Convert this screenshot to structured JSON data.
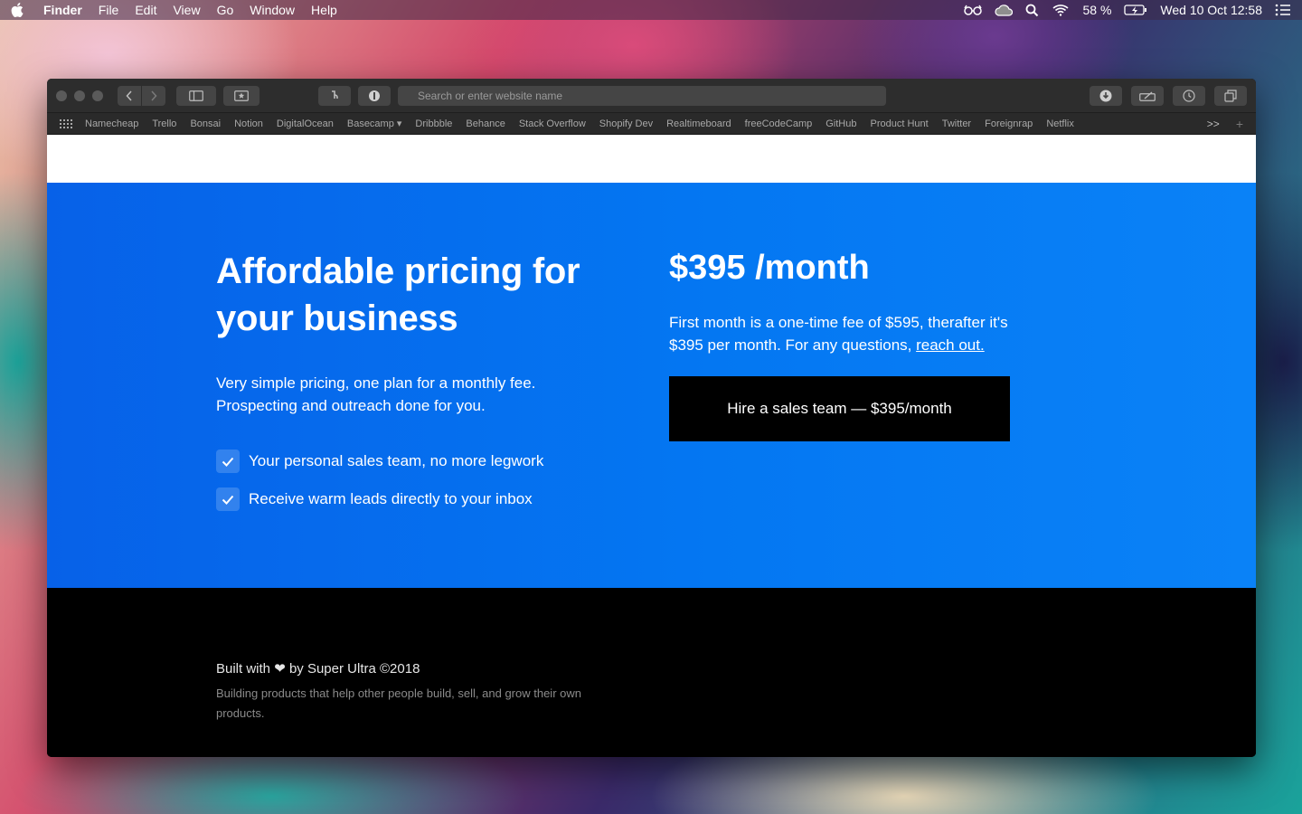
{
  "menubar": {
    "app_name": "Finder",
    "items": [
      "File",
      "Edit",
      "View",
      "Go",
      "Window",
      "Help"
    ],
    "battery": "58 %",
    "clock": "Wed 10 Oct  12:58"
  },
  "browser": {
    "address_placeholder": "Search or enter website name",
    "favorites": [
      "Namecheap",
      "Trello",
      "Bonsai",
      "Notion",
      "DigitalOcean",
      "Basecamp ▾",
      "Dribbble",
      "Behance",
      "Stack Overflow",
      "Shopify Dev",
      "Realtimeboard",
      "freeCodeCamp",
      "GitHub",
      "Product Hunt",
      "Twitter",
      "Foreignrap",
      "Netflix"
    ],
    "more_label": ">>",
    "add_tab_label": "+"
  },
  "hero": {
    "title_line1": "Affordable pricing for",
    "title_line2": "your business",
    "lead_line1": "Very simple pricing, one plan for a monthly fee.",
    "lead_line2": "Prospecting and outreach done for you.",
    "features": [
      "Your personal sales team, no more legwork",
      "Receive warm leads directly to your inbox"
    ],
    "price": "$395 /month",
    "note_text": "First month is a one-time fee of $595, therafter it's $395 per month. For any questions, ",
    "note_link": "reach out.",
    "cta_label": "Hire a sales team — $395/month"
  },
  "footer": {
    "built_prefix": "Built with",
    "heart": "❤",
    "built_suffix": "by Super Ultra ©2018",
    "tagline": "Building products that help other people build, sell, and grow their own products."
  },
  "colors": {
    "hero_start": "#0761e8",
    "hero_end": "#0a82f7",
    "cta_bg": "#000000",
    "footer_bg": "#000000"
  }
}
